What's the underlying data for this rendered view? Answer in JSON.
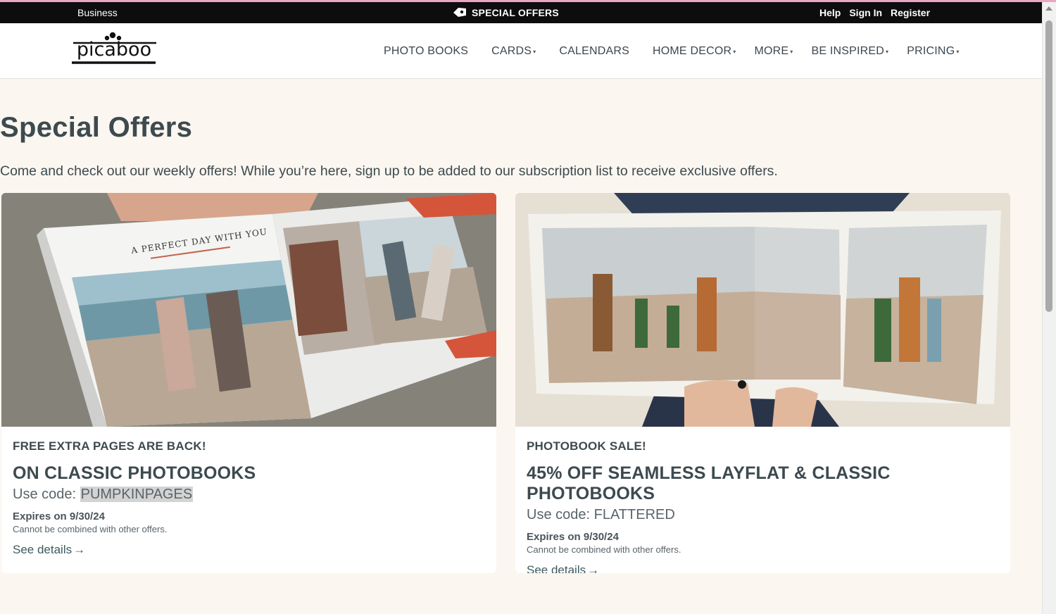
{
  "topbar": {
    "business": "Business",
    "special_offers": "SPECIAL OFFERS",
    "help": "Help",
    "sign_in": "Sign In",
    "register": "Register"
  },
  "brand": {
    "logo_text": "picaboo"
  },
  "nav": [
    {
      "label": "PHOTO BOOKS",
      "dropdown": false
    },
    {
      "label": "CARDS",
      "dropdown": true
    },
    {
      "label": "CALENDARS",
      "dropdown": false
    },
    {
      "label": "HOME DECOR",
      "dropdown": true
    },
    {
      "label": "MORE",
      "dropdown": true
    },
    {
      "label": "BE INSPIRED",
      "dropdown": true
    },
    {
      "label": "PRICING",
      "dropdown": true
    }
  ],
  "page": {
    "title": "Special Offers",
    "intro": "Come and check out our weekly offers! While you’re here, sign up to be added to our subscription list to receive exclusive offers."
  },
  "offers": [
    {
      "kicker": "FREE EXTRA PAGES ARE BACK!",
      "headline": "ON CLASSIC PHOTOBOOKS",
      "code_prefix": "Use code: ",
      "code": "PUMPKINPAGES",
      "expires": "Expires on 9/30/24",
      "fine_print": "Cannot be combined with other offers.",
      "details": "See details",
      "image_caption": "A PERFECT DAY WITH YOU"
    },
    {
      "kicker": "PHOTOBOOK SALE!",
      "headline": "45% OFF SEAMLESS LAYFLAT & CLASSIC PHOTOBOOKS",
      "code_prefix": "Use code: ",
      "code": "FLATTERED",
      "expires": "Expires on 9/30/24",
      "fine_print": "Cannot be combined with other offers.",
      "details": "See details"
    }
  ],
  "colors": {
    "topbar_bg": "#0d0d0d",
    "page_bg": "#fbf6f0",
    "text_dark": "#3d4a4f",
    "accent_orange": "#d4553a"
  }
}
